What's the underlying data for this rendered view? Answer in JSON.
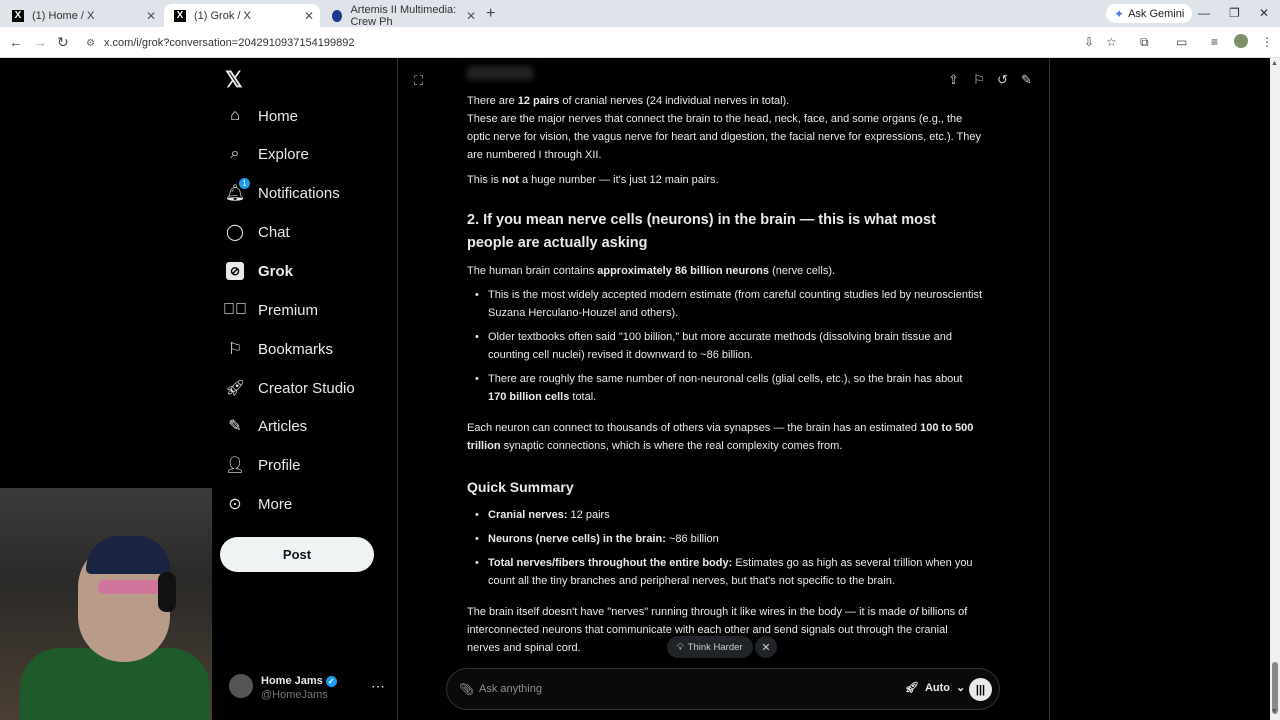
{
  "browser": {
    "tabs": [
      {
        "label": "(1) Home / X",
        "favicon": "X"
      },
      {
        "label": "(1) Grok / X",
        "favicon": "X",
        "active": true
      },
      {
        "label": "Artemis II Multimedia: Crew Ph",
        "favicon": "nasa"
      }
    ],
    "ask_gemini": "Ask Gemini",
    "url": "x.com/i/grok?conversation=2042910937154199892"
  },
  "sidebar": {
    "items": [
      {
        "label": "Home",
        "icon": "home-icon"
      },
      {
        "label": "Explore",
        "icon": "search-icon"
      },
      {
        "label": "Notifications",
        "icon": "bell-icon",
        "badge": "1"
      },
      {
        "label": "Chat",
        "icon": "chat-icon"
      },
      {
        "label": "Grok",
        "icon": "grok-icon"
      },
      {
        "label": "Premium",
        "icon": "premium-icon"
      },
      {
        "label": "Bookmarks",
        "icon": "bookmark-icon"
      },
      {
        "label": "Creator Studio",
        "icon": "rocket-icon"
      },
      {
        "label": "Articles",
        "icon": "articles-icon"
      },
      {
        "label": "Profile",
        "icon": "person-icon"
      },
      {
        "label": "More",
        "icon": "more-circle-icon"
      }
    ],
    "post_label": "Post",
    "user": {
      "name": "Home Jams",
      "handle": "@HomeJams"
    }
  },
  "conversation": {
    "p1_a": "There are ",
    "p1_b": "12 pairs",
    "p1_c": " of cranial nerves (24 individual nerves in total).",
    "p2": "These are the major nerves that connect the brain to the head, neck, face, and some organs (e.g., the optic nerve for vision, the vagus nerve for heart and digestion, the facial nerve for expressions, etc.). They are numbered I through XII.",
    "p3_a": "This is ",
    "p3_b": "not",
    "p3_c": " a huge number — it's just 12 main pairs.",
    "h2": "2. If you mean nerve cells (neurons) in the brain — this is what most people are actually asking",
    "p4_a": "The human brain contains ",
    "p4_b": "approximately 86 billion neurons",
    "p4_c": " (nerve cells).",
    "b1": "This is the most widely accepted modern estimate (from careful counting studies led by neuroscientist Suzana Herculano-Houzel and others).",
    "b2": "Older textbooks often said \"100 billion,\" but more accurate methods (dissolving brain tissue and counting cell nuclei) revised it downward to ~86 billion.",
    "b3_a": "There are roughly the same number of non-neuronal cells (glial cells, etc.), so the brain has about ",
    "b3_b": "170 billion cells",
    "b3_c": " total.",
    "p5_a": "Each neuron can connect to thousands of others via synapses — the brain has an estimated ",
    "p5_b": "100 to 500 trillion",
    "p5_c": " synaptic connections, which is where the real complexity comes from.",
    "h3": "Quick Summary",
    "s1_a": "Cranial nerves:",
    "s1_b": " 12 pairs",
    "s2_a": "Neurons (nerve cells) in the brain:",
    "s2_b": " ~86 billion",
    "s3_a": "Total nerves/fibers throughout the entire body:",
    "s3_b": " Estimates go as high as several trillion when you count all the tiny branches and peripheral nerves, but that's not specific to the brain.",
    "p6_a": "The brain itself doesn't have \"nerves\" running through it like wires in the body — it is made ",
    "p6_b": "of",
    "p6_c": " billions of interconnected neurons that communicate with each other and send signals out through the cranial nerves and spinal cord."
  },
  "composer": {
    "think_harder": "Think Harder",
    "placeholder": "Ask anything",
    "mode": "Auto"
  }
}
